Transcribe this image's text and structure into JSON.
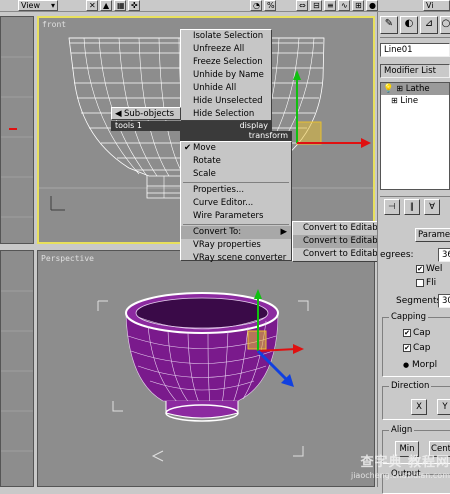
{
  "toolbar": {
    "view_label": "View",
    "right_label": "Vi"
  },
  "viewports": {
    "front_label": "front",
    "perspective_label": "Perspective"
  },
  "quad_menu": {
    "top_items": [
      "Isolate Selection",
      "Unfreeze All",
      "Freeze Selection",
      "Unhide by Name",
      "Unhide All",
      "Hide Unselected",
      "Hide Selection"
    ],
    "sub_objects_label": "Sub-objects",
    "tools1_label": "tools 1",
    "display_label": "display",
    "transform_label": "transform",
    "transform_items": [
      "Move",
      "Rotate",
      "Scale"
    ],
    "checked_item": "Move",
    "lower_items": [
      "Properties...",
      "Curve Editor...",
      "Wire Parameters"
    ],
    "convert_to_label": "Convert To:",
    "bottom_items": [
      "VRay properties",
      "VRay scene converter"
    ],
    "submenu_items": [
      "Convert to Editable Mesh",
      "Convert to Editable Poly",
      "Convert to Editable Patch"
    ]
  },
  "panel": {
    "object_name": "Line01",
    "modifier_list_label": "Modifier List",
    "stack": [
      "Lathe",
      "Line"
    ],
    "params_label": "Parame",
    "degrees_label": "egrees:",
    "degrees_value": "36",
    "weld_label": "Wel",
    "flip_label": "Fli",
    "segments_label": "Segments:",
    "segments_value": "30",
    "capping_label": "Capping",
    "cap_start_label": "Cap",
    "cap_end_label": "Cap",
    "morph_label": "Morpl",
    "direction_label": "Direction",
    "x_label": "X",
    "y_label": "Y",
    "align_label": "Align",
    "min_label": "Min",
    "center_label": "Cent",
    "output_label": "Output"
  },
  "watermark": {
    "line1": "查字典 教程网",
    "line2": "jiaocheng.chazidian.com"
  },
  "colors": {
    "selection_yellow": "#e8e05c",
    "bowl_purple": "#7a1a8c",
    "axis_red": "#e01010",
    "axis_green": "#10c010",
    "axis_blue": "#1040e0",
    "menu_highlight": "#a8a8a8"
  }
}
